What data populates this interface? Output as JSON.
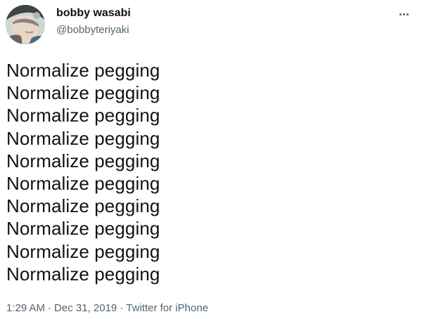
{
  "tweet": {
    "author": {
      "display_name": "bobby wasabi",
      "handle": "@bobbyteriyaki",
      "avatar": "profile-photo"
    },
    "more_icon": "ellipsis-icon",
    "lines": [
      "Normalize pegging",
      "Normalize pegging",
      "Normalize pegging",
      "Normalize pegging",
      "Normalize pegging",
      "Normalize pegging",
      "Normalize pegging",
      "Normalize pegging",
      "Normalize pegging",
      "Normalize pegging"
    ],
    "meta": {
      "time": "1:29 AM",
      "date": "Dec 31, 2019",
      "separator": "·",
      "source": "Twitter for iPhone"
    }
  },
  "colors": {
    "text_primary": "#0f1419",
    "text_secondary": "#536471",
    "background": "#ffffff"
  }
}
